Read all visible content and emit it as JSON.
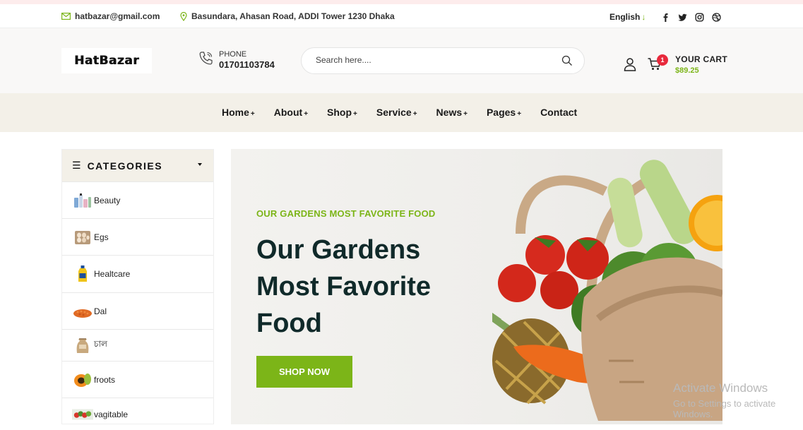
{
  "topbar": {
    "email": "hatbazar@gmail.com",
    "address": "Basundara, Ahasan Road, ADDI Tower 1230 Dhaka",
    "language": "English",
    "social_icons": [
      "facebook-icon",
      "twitter-icon",
      "instagram-icon",
      "dribbble-icon"
    ]
  },
  "header": {
    "logo_text": "HatBazar",
    "phone_label": "PHONE",
    "phone_number": "01701103784",
    "search_placeholder": "Search here....",
    "cart_count": "1",
    "cart_label": "YOUR CART",
    "cart_total": "$89.25"
  },
  "nav": {
    "items": [
      {
        "label": "Home",
        "plus": "+"
      },
      {
        "label": "About",
        "plus": "+"
      },
      {
        "label": "Shop",
        "plus": "+"
      },
      {
        "label": "Service",
        "plus": "+"
      },
      {
        "label": "News",
        "plus": "+"
      },
      {
        "label": "Pages",
        "plus": "+"
      },
      {
        "label": "Contact",
        "plus": ""
      }
    ]
  },
  "categories": {
    "title": "CATEGORIES",
    "items": [
      {
        "label": "Beauty",
        "icon": "cosmetics-icon"
      },
      {
        "label": "Egs",
        "icon": "egg-tray-icon"
      },
      {
        "label": "Healtcare",
        "icon": "oil-bottle-icon"
      },
      {
        "label": "Dal",
        "icon": "lentils-icon"
      },
      {
        "label": "চাল",
        "icon": "rice-sack-icon"
      },
      {
        "label": "froots",
        "icon": "papaya-icon"
      },
      {
        "label": "vagitable",
        "icon": "vegetables-icon"
      }
    ]
  },
  "hero": {
    "subtitle": "OUR GARDENS MOST FAVORITE FOOD",
    "heading": "Our Gardens Most Favorite Food",
    "button_label": "SHOP NOW"
  },
  "watermark": {
    "line1": "Activate Windows",
    "line2": "Go to Settings to activate Windows."
  },
  "colors": {
    "accent_green": "#7cb518",
    "badge_red": "#e8293c",
    "nav_background": "#f3f0e8",
    "heading_dark": "#102a2a"
  }
}
